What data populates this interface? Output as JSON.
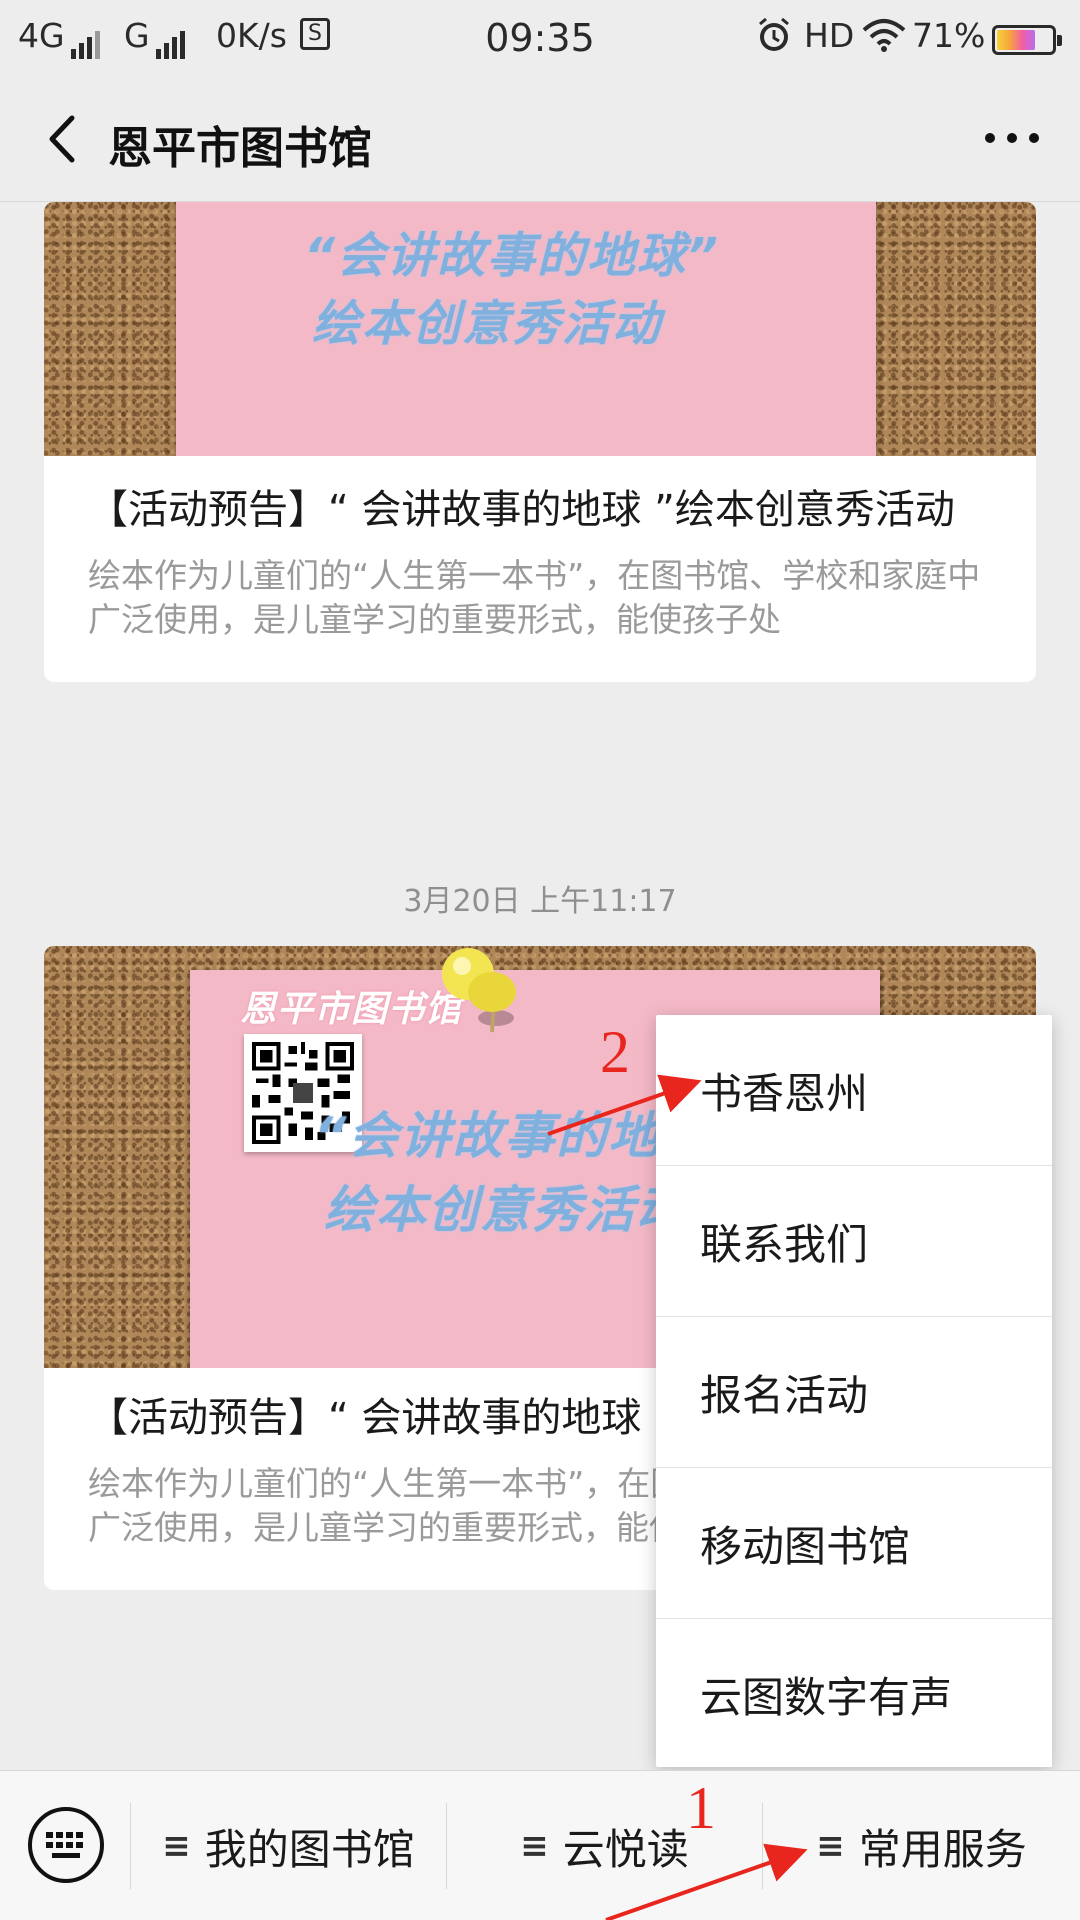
{
  "status_bar": {
    "network_1": "4G",
    "network_2": "G",
    "speed": "0K/s",
    "speed_icon": "S",
    "time": "09:35",
    "hd": "HD",
    "battery_pct": "71%",
    "battery_level": 0.71
  },
  "header": {
    "title": "恩平市图书馆"
  },
  "articles": [
    {
      "note_line1": "“会讲故事的地球”",
      "note_line2": "绘本创意秀活动",
      "title": "【活动预告】“ 会讲故事的地球 ”绘本创意秀活动",
      "desc": "绘本作为儿童们的“人生第一本书”，在图书馆、学校和家庭中广泛使用，是儿童学习的重要形式，能使孩子处"
    },
    {
      "timestamp": "3月20日 上午11:17",
      "brand": "恩平市图书馆",
      "note_line1": "“会讲故事的地球”",
      "note_line2": "绘本创意秀活动",
      "title": "【活动预告】“ 会讲故事的地球 ”绘本创意秀活动",
      "desc": "绘本作为儿童们的“人生第一本书”，在图书馆、学校和家庭中广泛使用，是儿童学习的重要形式，能使孩子处"
    }
  ],
  "popup_menu": {
    "items": [
      "书香恩州",
      "联系我们",
      "报名活动",
      "移动图书馆",
      "云图数字有声"
    ]
  },
  "bottom_menu": {
    "hamburger": "≡",
    "items": [
      "我的图书馆",
      "云悦读",
      "常用服务"
    ]
  },
  "annotations": {
    "step1": "1",
    "step2": "2",
    "color": "#e8261e"
  }
}
